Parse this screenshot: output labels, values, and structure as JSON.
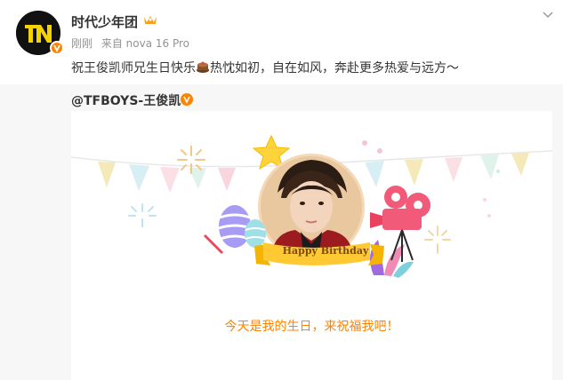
{
  "post": {
    "author": "时代少年团",
    "time": "刚刚",
    "source": "来自 nova 16 Pro",
    "text": "祝王俊凯师兄生日快乐",
    "text_after_emoji": "热忱如初，自在如风，奔赴更多热爱与远方～",
    "emoji_icon": "cake-emoji"
  },
  "repost": {
    "author": "@TFBOYS-王俊凯",
    "card": {
      "banner": "Happy Birthday",
      "message": "今天是我的生日，来祝福我吧！"
    }
  },
  "colors": {
    "accent": "#ff8200",
    "repost_bg": "#f7f7f7"
  }
}
